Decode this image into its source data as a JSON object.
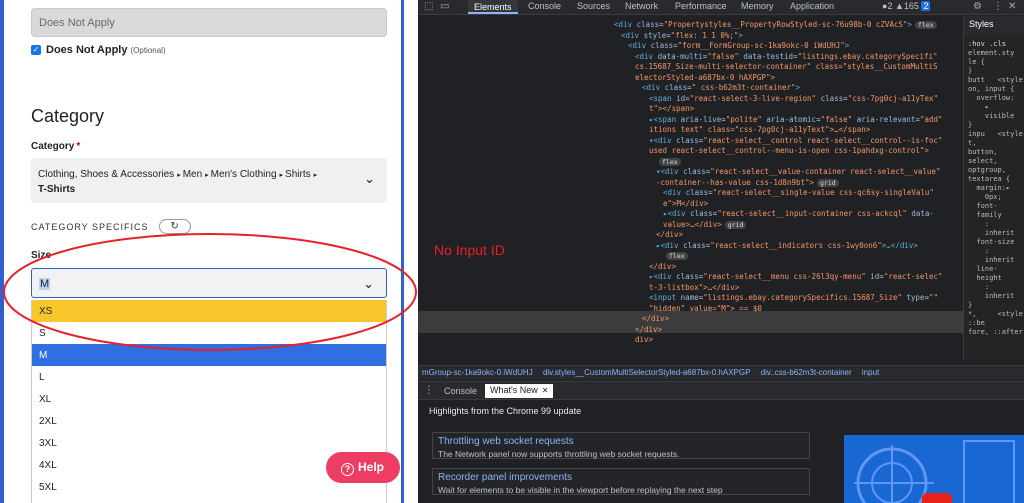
{
  "form": {
    "does_not_apply_input": "Does Not Apply",
    "does_not_apply_checkbox_label": "Does Not Apply",
    "does_not_apply_optional": "(Optional)",
    "category_heading": "Category",
    "category_label": "Category",
    "required_mark": "*",
    "breadcrumb": [
      "Clothing, Shoes & Accessories",
      "Men",
      "Men's Clothing",
      "Shirts"
    ],
    "breadcrumb_separator": "▸",
    "breadcrumb_leaf": "T-Shirts",
    "specifics_label": "CATEGORY SPECIFICS",
    "refresh_icon": "↻",
    "size_label": "Size",
    "size_value": "M",
    "size_options": [
      "XS",
      "S",
      "M",
      "L",
      "XL",
      "2XL",
      "3XL",
      "4XL",
      "5XL"
    ],
    "highlighted_option": "XS",
    "selected_option": "M",
    "help_label": "Help",
    "help_icon": "?",
    "checkbox_icon": "✓",
    "chevron_icon": "⌄"
  },
  "devtools": {
    "tabs": [
      "Elements",
      "Console",
      "Sources",
      "Network",
      "Performance",
      "Memory",
      "Application"
    ],
    "active_tab": "Elements",
    "counts": {
      "errors": "2",
      "warnings": "165",
      "info": "2"
    },
    "dom_lines": [
      {
        "indent": 0,
        "open": "<div ",
        "attrs": [
          [
            "class",
            "Propertystyles__PropertyRowStyled-sc-76u98b-0 cZVAcS"
          ]
        ],
        "close": ">",
        "badge": "flex"
      },
      {
        "indent": 1,
        "open": "<div ",
        "attrs": [
          [
            "style",
            "flex: 1 1 0%;"
          ]
        ],
        "close": ">",
        "badge": ""
      },
      {
        "indent": 2,
        "open": "<div ",
        "attrs": [
          [
            "class",
            "form__FormGroup-sc-1ka9okc-0 iWdUHJ"
          ]
        ],
        "close": ">",
        "badge": ""
      },
      {
        "indent": 3,
        "open": "<div ",
        "attrs": [
          [
            "data-multi",
            "false"
          ],
          [
            "data-testid",
            "listings.ebay.categorySpecifi"
          ]
        ],
        "close": "",
        "badge": ""
      },
      {
        "indent": 3,
        "open": "",
        "attrs": [],
        "raw": "cs.15687_Size-multi-selector-container\" class=\"styles__CustomMultiS",
        "close": "",
        "badge": ""
      },
      {
        "indent": 3,
        "open": "",
        "attrs": [],
        "raw": "electorStyled-a687bx-0 hAXPGP\">",
        "close": "",
        "badge": ""
      },
      {
        "indent": 4,
        "open": "<div ",
        "attrs": [
          [
            "class",
            " css-b62m3t-container"
          ]
        ],
        "close": ">",
        "badge": ""
      },
      {
        "indent": 5,
        "open": "<span ",
        "attrs": [
          [
            "id",
            "react-select-3-live-region"
          ],
          [
            "class",
            "css-7pg0cj-a11yTex"
          ]
        ],
        "close": "",
        "badge": ""
      },
      {
        "indent": 5,
        "open": "",
        "attrs": [],
        "raw": "t\"></span>",
        "close": "",
        "badge": ""
      },
      {
        "indent": 5,
        "open": "▸<span ",
        "attrs": [
          [
            "aria-live",
            "polite"
          ],
          [
            "aria-atomic",
            "false"
          ],
          [
            "aria-relevant",
            "add"
          ]
        ],
        "close": "",
        "badge": ""
      },
      {
        "indent": 5,
        "open": "",
        "attrs": [],
        "raw": "itions text\" class=\"css-7pg0cj-a11yText\">…</span>",
        "close": "",
        "badge": ""
      },
      {
        "indent": 5,
        "open": "▾<div ",
        "attrs": [
          [
            "class",
            "react-select__control react-select__control--is-foc"
          ]
        ],
        "close": "",
        "badge": ""
      },
      {
        "indent": 5,
        "open": "",
        "attrs": [],
        "raw": "used react-select__control--menu-is-open css-1pahdxg-control\">",
        "close": "",
        "badge": ""
      },
      {
        "indent": 6,
        "open": "",
        "attrs": [],
        "raw": "",
        "close": "",
        "badge": "flex"
      },
      {
        "indent": 6,
        "open": "▾<div ",
        "attrs": [
          [
            "class",
            "react-select__value-container react-select__value"
          ]
        ],
        "close": "",
        "badge": ""
      },
      {
        "indent": 6,
        "open": "",
        "attrs": [],
        "raw": "-container--has-value css-1d8n9bt\">",
        "close": "",
        "badge": "grid"
      },
      {
        "indent": 7,
        "open": "<div ",
        "attrs": [
          [
            "class",
            "react-select__single-value css-qc6sy-singleValu"
          ]
        ],
        "close": "",
        "badge": ""
      },
      {
        "indent": 7,
        "open": "",
        "attrs": [],
        "raw": "e\">M</div>",
        "close": "",
        "badge": ""
      },
      {
        "indent": 7,
        "open": "▸<div ",
        "attrs": [
          [
            "class",
            "react-select__input-container css-ackcql"
          ],
          [
            "data-",
            ""
          ]
        ],
        "close": "",
        "badge": ""
      },
      {
        "indent": 7,
        "open": "",
        "attrs": [],
        "raw": "value>…</div>",
        "close": "",
        "badge": "grid"
      },
      {
        "indent": 6,
        "open": "",
        "attrs": [],
        "raw": "</div>",
        "close": "",
        "badge": ""
      },
      {
        "indent": 6,
        "open": "▸<div ",
        "attrs": [
          [
            "class",
            "react-select__indicators css-1wy0on6"
          ]
        ],
        "close": ">…</div>",
        "badge": ""
      },
      {
        "indent": 7,
        "open": "",
        "attrs": [],
        "raw": "",
        "close": "",
        "badge": "flex"
      },
      {
        "indent": 5,
        "open": "",
        "attrs": [],
        "raw": "</div>",
        "close": "",
        "badge": ""
      },
      {
        "indent": 5,
        "open": "▸<div ",
        "attrs": [
          [
            "class",
            "react-select__menu css-26l3qy-menu"
          ],
          [
            "id",
            "react-selec"
          ]
        ],
        "close": "",
        "badge": ""
      },
      {
        "indent": 5,
        "open": "",
        "attrs": [],
        "raw": "t-3-listbox\">…</div>",
        "close": "",
        "badge": ""
      },
      {
        "indent": 5,
        "open": "<input ",
        "attrs": [
          [
            "name",
            "listings.ebay.categorySpecifics.15687_Size"
          ],
          [
            "type",
            ""
          ]
        ],
        "close": "",
        "badge": ""
      },
      {
        "indent": 5,
        "open": "",
        "attrs": [],
        "raw": "\"hidden\" value=\"M\"> == $0",
        "close": "",
        "badge": ""
      },
      {
        "indent": 4,
        "open": "",
        "attrs": [],
        "raw": "</div>",
        "close": "",
        "badge": ""
      },
      {
        "indent": 3,
        "open": "",
        "attrs": [],
        "raw": "</div>",
        "close": "",
        "badge": ""
      },
      {
        "indent": 3,
        "open": "",
        "attrs": [],
        "raw": "div>",
        "close": "",
        "badge": ""
      }
    ],
    "annotation": "No Input ID",
    "annotation_color": "#e8202a",
    "styles_tab": "Styles",
    "styles_filter": ":hov .cls",
    "styles_rules": [
      "element.sty",
      "le {",
      "}",
      "butt   <style",
      "on, input {",
      "  overflow:",
      "    ▸",
      "    visible",
      "}",
      "inpu   <style",
      "t,",
      "button,",
      "select,",
      "optgroup,",
      "textarea {",
      "  margin:▸",
      "    0px;",
      "  font-",
      "  family",
      "    :",
      "    inherit",
      "  font-size",
      "    :",
      "    inherit",
      "  line-",
      "  height",
      "    :",
      "    inherit",
      "}",
      "*,     <style",
      "::be",
      "fore, ::after"
    ],
    "breadcrumbs": [
      "mGroup-sc-1ka9okc-0.iWdUHJ",
      "div.styles__CustomMultiSelectorStyled-a687bx-0.hAXPGP",
      "div..css-b62m3t-container",
      "input"
    ],
    "drawer_tabs": [
      "Console",
      "What's New"
    ],
    "drawer_active": "What's New",
    "highlights": "Highlights from the Chrome 99 update",
    "cards": [
      {
        "title": "Throttling web socket requests",
        "subtitle": "The Network panel now supports throttling web socket requests."
      },
      {
        "title": "Recorder panel improvements",
        "subtitle": "Wait for elements to be visible in the viewport before replaying the next step"
      }
    ]
  }
}
